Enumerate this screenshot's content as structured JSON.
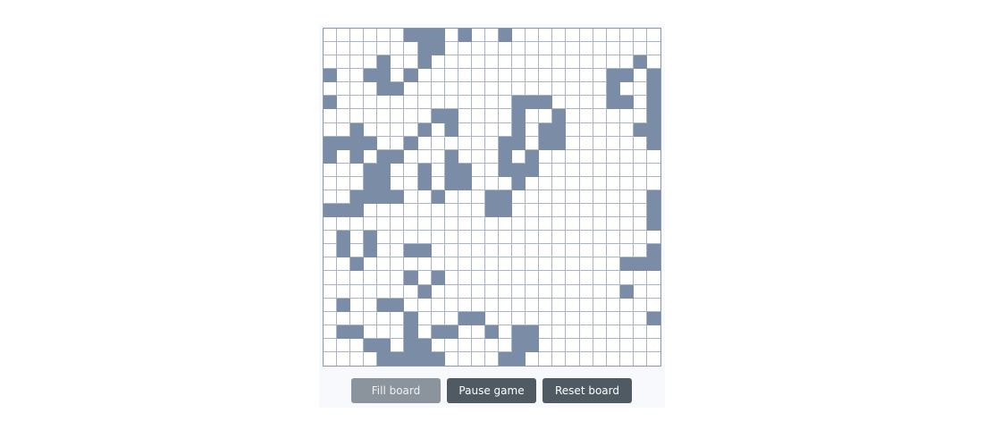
{
  "board": {
    "rows": 25,
    "cols": 25,
    "alive": [
      [
        0,
        6
      ],
      [
        0,
        7
      ],
      [
        0,
        8
      ],
      [
        0,
        10
      ],
      [
        0,
        13
      ],
      [
        1,
        7
      ],
      [
        1,
        8
      ],
      [
        2,
        4
      ],
      [
        2,
        7
      ],
      [
        2,
        23
      ],
      [
        3,
        0
      ],
      [
        3,
        3
      ],
      [
        3,
        4
      ],
      [
        3,
        6
      ],
      [
        3,
        21
      ],
      [
        3,
        22
      ],
      [
        3,
        24
      ],
      [
        4,
        4
      ],
      [
        4,
        5
      ],
      [
        4,
        21
      ],
      [
        4,
        24
      ],
      [
        5,
        0
      ],
      [
        5,
        14
      ],
      [
        5,
        15
      ],
      [
        5,
        16
      ],
      [
        5,
        21
      ],
      [
        5,
        22
      ],
      [
        5,
        24
      ],
      [
        6,
        8
      ],
      [
        6,
        9
      ],
      [
        6,
        14
      ],
      [
        6,
        17
      ],
      [
        6,
        24
      ],
      [
        7,
        2
      ],
      [
        7,
        7
      ],
      [
        7,
        9
      ],
      [
        7,
        14
      ],
      [
        7,
        16
      ],
      [
        7,
        17
      ],
      [
        7,
        23
      ],
      [
        7,
        24
      ],
      [
        8,
        0
      ],
      [
        8,
        1
      ],
      [
        8,
        2
      ],
      [
        8,
        3
      ],
      [
        8,
        6
      ],
      [
        8,
        13
      ],
      [
        8,
        14
      ],
      [
        8,
        16
      ],
      [
        8,
        17
      ],
      [
        8,
        24
      ],
      [
        9,
        0
      ],
      [
        9,
        2
      ],
      [
        9,
        4
      ],
      [
        9,
        5
      ],
      [
        9,
        9
      ],
      [
        9,
        13
      ],
      [
        9,
        15
      ],
      [
        10,
        3
      ],
      [
        10,
        4
      ],
      [
        10,
        7
      ],
      [
        10,
        9
      ],
      [
        10,
        10
      ],
      [
        10,
        13
      ],
      [
        10,
        14
      ],
      [
        10,
        15
      ],
      [
        11,
        3
      ],
      [
        11,
        4
      ],
      [
        11,
        7
      ],
      [
        11,
        9
      ],
      [
        11,
        10
      ],
      [
        11,
        14
      ],
      [
        12,
        2
      ],
      [
        12,
        3
      ],
      [
        12,
        4
      ],
      [
        12,
        5
      ],
      [
        12,
        8
      ],
      [
        12,
        12
      ],
      [
        12,
        13
      ],
      [
        12,
        24
      ],
      [
        13,
        0
      ],
      [
        13,
        1
      ],
      [
        13,
        2
      ],
      [
        13,
        12
      ],
      [
        13,
        13
      ],
      [
        13,
        24
      ],
      [
        14,
        24
      ],
      [
        15,
        1
      ],
      [
        15,
        3
      ],
      [
        16,
        1
      ],
      [
        16,
        3
      ],
      [
        16,
        6
      ],
      [
        16,
        7
      ],
      [
        16,
        24
      ],
      [
        17,
        2
      ],
      [
        17,
        22
      ],
      [
        17,
        23
      ],
      [
        17,
        24
      ],
      [
        18,
        6
      ],
      [
        18,
        8
      ],
      [
        19,
        7
      ],
      [
        19,
        22
      ],
      [
        20,
        1
      ],
      [
        20,
        4
      ],
      [
        20,
        5
      ],
      [
        21,
        6
      ],
      [
        21,
        10
      ],
      [
        21,
        11
      ],
      [
        21,
        24
      ],
      [
        22,
        1
      ],
      [
        22,
        2
      ],
      [
        22,
        6
      ],
      [
        22,
        8
      ],
      [
        22,
        9
      ],
      [
        22,
        12
      ],
      [
        22,
        14
      ],
      [
        22,
        15
      ],
      [
        23,
        3
      ],
      [
        23,
        4
      ],
      [
        23,
        6
      ],
      [
        23,
        7
      ],
      [
        23,
        14
      ],
      [
        23,
        15
      ],
      [
        24,
        4
      ],
      [
        24,
        5
      ],
      [
        24,
        6
      ],
      [
        24,
        7
      ],
      [
        24,
        8
      ],
      [
        24,
        13
      ],
      [
        24,
        14
      ]
    ]
  },
  "controls": {
    "fill_label": "Fill board",
    "pause_label": "Pause game",
    "reset_label": "Reset board"
  },
  "colors": {
    "alive": "#7a8ca6",
    "dead": "#ffffff",
    "grid_line": "#a9b4c7",
    "fill_button": "#8b949c",
    "action_button": "#4f5a63"
  }
}
